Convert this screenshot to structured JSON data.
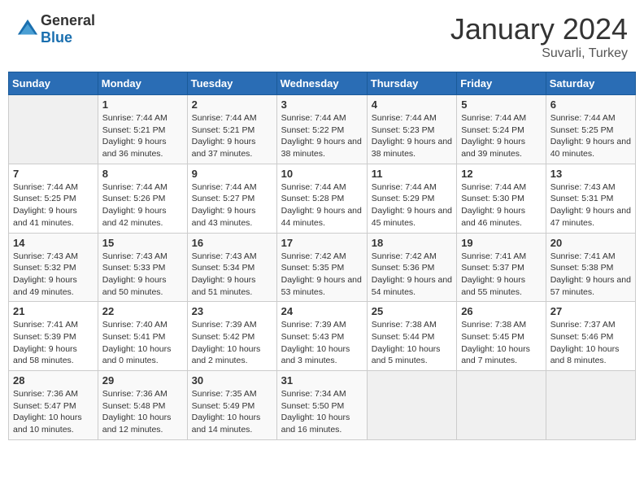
{
  "logo": {
    "general": "General",
    "blue": "Blue"
  },
  "header": {
    "month": "January 2024",
    "location": "Suvarli, Turkey"
  },
  "weekdays": [
    "Sunday",
    "Monday",
    "Tuesday",
    "Wednesday",
    "Thursday",
    "Friday",
    "Saturday"
  ],
  "weeks": [
    [
      {
        "day": "",
        "sunrise": "",
        "sunset": "",
        "daylight": ""
      },
      {
        "day": "1",
        "sunrise": "Sunrise: 7:44 AM",
        "sunset": "Sunset: 5:21 PM",
        "daylight": "Daylight: 9 hours and 36 minutes."
      },
      {
        "day": "2",
        "sunrise": "Sunrise: 7:44 AM",
        "sunset": "Sunset: 5:21 PM",
        "daylight": "Daylight: 9 hours and 37 minutes."
      },
      {
        "day": "3",
        "sunrise": "Sunrise: 7:44 AM",
        "sunset": "Sunset: 5:22 PM",
        "daylight": "Daylight: 9 hours and 38 minutes."
      },
      {
        "day": "4",
        "sunrise": "Sunrise: 7:44 AM",
        "sunset": "Sunset: 5:23 PM",
        "daylight": "Daylight: 9 hours and 38 minutes."
      },
      {
        "day": "5",
        "sunrise": "Sunrise: 7:44 AM",
        "sunset": "Sunset: 5:24 PM",
        "daylight": "Daylight: 9 hours and 39 minutes."
      },
      {
        "day": "6",
        "sunrise": "Sunrise: 7:44 AM",
        "sunset": "Sunset: 5:25 PM",
        "daylight": "Daylight: 9 hours and 40 minutes."
      }
    ],
    [
      {
        "day": "7",
        "sunrise": "Sunrise: 7:44 AM",
        "sunset": "Sunset: 5:25 PM",
        "daylight": "Daylight: 9 hours and 41 minutes."
      },
      {
        "day": "8",
        "sunrise": "Sunrise: 7:44 AM",
        "sunset": "Sunset: 5:26 PM",
        "daylight": "Daylight: 9 hours and 42 minutes."
      },
      {
        "day": "9",
        "sunrise": "Sunrise: 7:44 AM",
        "sunset": "Sunset: 5:27 PM",
        "daylight": "Daylight: 9 hours and 43 minutes."
      },
      {
        "day": "10",
        "sunrise": "Sunrise: 7:44 AM",
        "sunset": "Sunset: 5:28 PM",
        "daylight": "Daylight: 9 hours and 44 minutes."
      },
      {
        "day": "11",
        "sunrise": "Sunrise: 7:44 AM",
        "sunset": "Sunset: 5:29 PM",
        "daylight": "Daylight: 9 hours and 45 minutes."
      },
      {
        "day": "12",
        "sunrise": "Sunrise: 7:44 AM",
        "sunset": "Sunset: 5:30 PM",
        "daylight": "Daylight: 9 hours and 46 minutes."
      },
      {
        "day": "13",
        "sunrise": "Sunrise: 7:43 AM",
        "sunset": "Sunset: 5:31 PM",
        "daylight": "Daylight: 9 hours and 47 minutes."
      }
    ],
    [
      {
        "day": "14",
        "sunrise": "Sunrise: 7:43 AM",
        "sunset": "Sunset: 5:32 PM",
        "daylight": "Daylight: 9 hours and 49 minutes."
      },
      {
        "day": "15",
        "sunrise": "Sunrise: 7:43 AM",
        "sunset": "Sunset: 5:33 PM",
        "daylight": "Daylight: 9 hours and 50 minutes."
      },
      {
        "day": "16",
        "sunrise": "Sunrise: 7:43 AM",
        "sunset": "Sunset: 5:34 PM",
        "daylight": "Daylight: 9 hours and 51 minutes."
      },
      {
        "day": "17",
        "sunrise": "Sunrise: 7:42 AM",
        "sunset": "Sunset: 5:35 PM",
        "daylight": "Daylight: 9 hours and 53 minutes."
      },
      {
        "day": "18",
        "sunrise": "Sunrise: 7:42 AM",
        "sunset": "Sunset: 5:36 PM",
        "daylight": "Daylight: 9 hours and 54 minutes."
      },
      {
        "day": "19",
        "sunrise": "Sunrise: 7:41 AM",
        "sunset": "Sunset: 5:37 PM",
        "daylight": "Daylight: 9 hours and 55 minutes."
      },
      {
        "day": "20",
        "sunrise": "Sunrise: 7:41 AM",
        "sunset": "Sunset: 5:38 PM",
        "daylight": "Daylight: 9 hours and 57 minutes."
      }
    ],
    [
      {
        "day": "21",
        "sunrise": "Sunrise: 7:41 AM",
        "sunset": "Sunset: 5:39 PM",
        "daylight": "Daylight: 9 hours and 58 minutes."
      },
      {
        "day": "22",
        "sunrise": "Sunrise: 7:40 AM",
        "sunset": "Sunset: 5:41 PM",
        "daylight": "Daylight: 10 hours and 0 minutes."
      },
      {
        "day": "23",
        "sunrise": "Sunrise: 7:39 AM",
        "sunset": "Sunset: 5:42 PM",
        "daylight": "Daylight: 10 hours and 2 minutes."
      },
      {
        "day": "24",
        "sunrise": "Sunrise: 7:39 AM",
        "sunset": "Sunset: 5:43 PM",
        "daylight": "Daylight: 10 hours and 3 minutes."
      },
      {
        "day": "25",
        "sunrise": "Sunrise: 7:38 AM",
        "sunset": "Sunset: 5:44 PM",
        "daylight": "Daylight: 10 hours and 5 minutes."
      },
      {
        "day": "26",
        "sunrise": "Sunrise: 7:38 AM",
        "sunset": "Sunset: 5:45 PM",
        "daylight": "Daylight: 10 hours and 7 minutes."
      },
      {
        "day": "27",
        "sunrise": "Sunrise: 7:37 AM",
        "sunset": "Sunset: 5:46 PM",
        "daylight": "Daylight: 10 hours and 8 minutes."
      }
    ],
    [
      {
        "day": "28",
        "sunrise": "Sunrise: 7:36 AM",
        "sunset": "Sunset: 5:47 PM",
        "daylight": "Daylight: 10 hours and 10 minutes."
      },
      {
        "day": "29",
        "sunrise": "Sunrise: 7:36 AM",
        "sunset": "Sunset: 5:48 PM",
        "daylight": "Daylight: 10 hours and 12 minutes."
      },
      {
        "day": "30",
        "sunrise": "Sunrise: 7:35 AM",
        "sunset": "Sunset: 5:49 PM",
        "daylight": "Daylight: 10 hours and 14 minutes."
      },
      {
        "day": "31",
        "sunrise": "Sunrise: 7:34 AM",
        "sunset": "Sunset: 5:50 PM",
        "daylight": "Daylight: 10 hours and 16 minutes."
      },
      {
        "day": "",
        "sunrise": "",
        "sunset": "",
        "daylight": ""
      },
      {
        "day": "",
        "sunrise": "",
        "sunset": "",
        "daylight": ""
      },
      {
        "day": "",
        "sunrise": "",
        "sunset": "",
        "daylight": ""
      }
    ]
  ]
}
